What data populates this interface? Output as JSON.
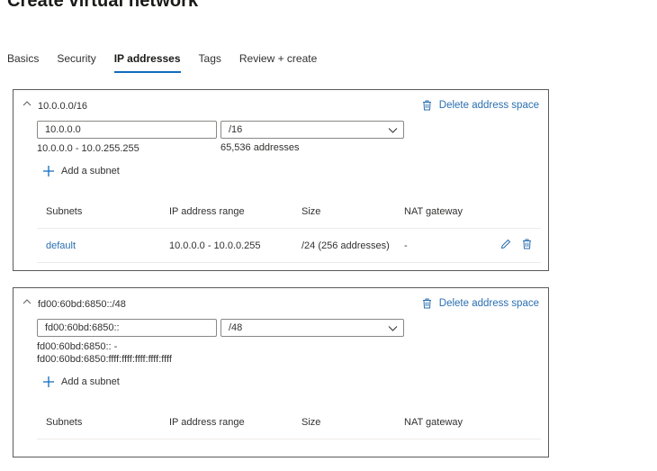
{
  "header": {
    "title": "Create virtual network",
    "more_icon": "more-ellipsis-icon",
    "more_glyph": "···"
  },
  "tabs": [
    {
      "label": "Basics",
      "active": false
    },
    {
      "label": "Security",
      "active": false
    },
    {
      "label": "IP addresses",
      "active": true
    },
    {
      "label": "Tags",
      "active": false
    },
    {
      "label": "Review + create",
      "active": false
    }
  ],
  "colors": {
    "accent": "#0f6cbd",
    "link": "#2a6fb0",
    "text": "#323130",
    "border": "#5a5a5a"
  },
  "address_spaces": [
    {
      "label": "10.0.0.0/16",
      "delete_label": "Delete address space",
      "address_value": "10.0.0.0",
      "prefix_value": "/16",
      "range_line1": "10.0.0.0 - 10.0.255.255",
      "range_line2": "",
      "address_count": "65,536 addresses",
      "add_subnet_label": "Add a subnet",
      "table_headers": [
        "Subnets",
        "IP address range",
        "Size",
        "NAT gateway"
      ],
      "subnets": [
        {
          "name": "default",
          "range": "10.0.0.0 - 10.0.0.255",
          "size": "/24 (256 addresses)",
          "nat_gateway": "-"
        }
      ]
    },
    {
      "label": "fd00:60bd:6850::/48",
      "delete_label": "Delete address space",
      "address_value": "fd00:60bd:6850::",
      "prefix_value": "/48",
      "range_line1": "fd00:60bd:6850:: -",
      "range_line2": "fd00:60bd:6850:ffff:ffff:ffff:ffff:ffff",
      "address_count": "",
      "add_subnet_label": "Add a subnet",
      "table_headers": [
        "Subnets",
        "IP address range",
        "Size",
        "NAT gateway"
      ],
      "subnets": []
    }
  ]
}
